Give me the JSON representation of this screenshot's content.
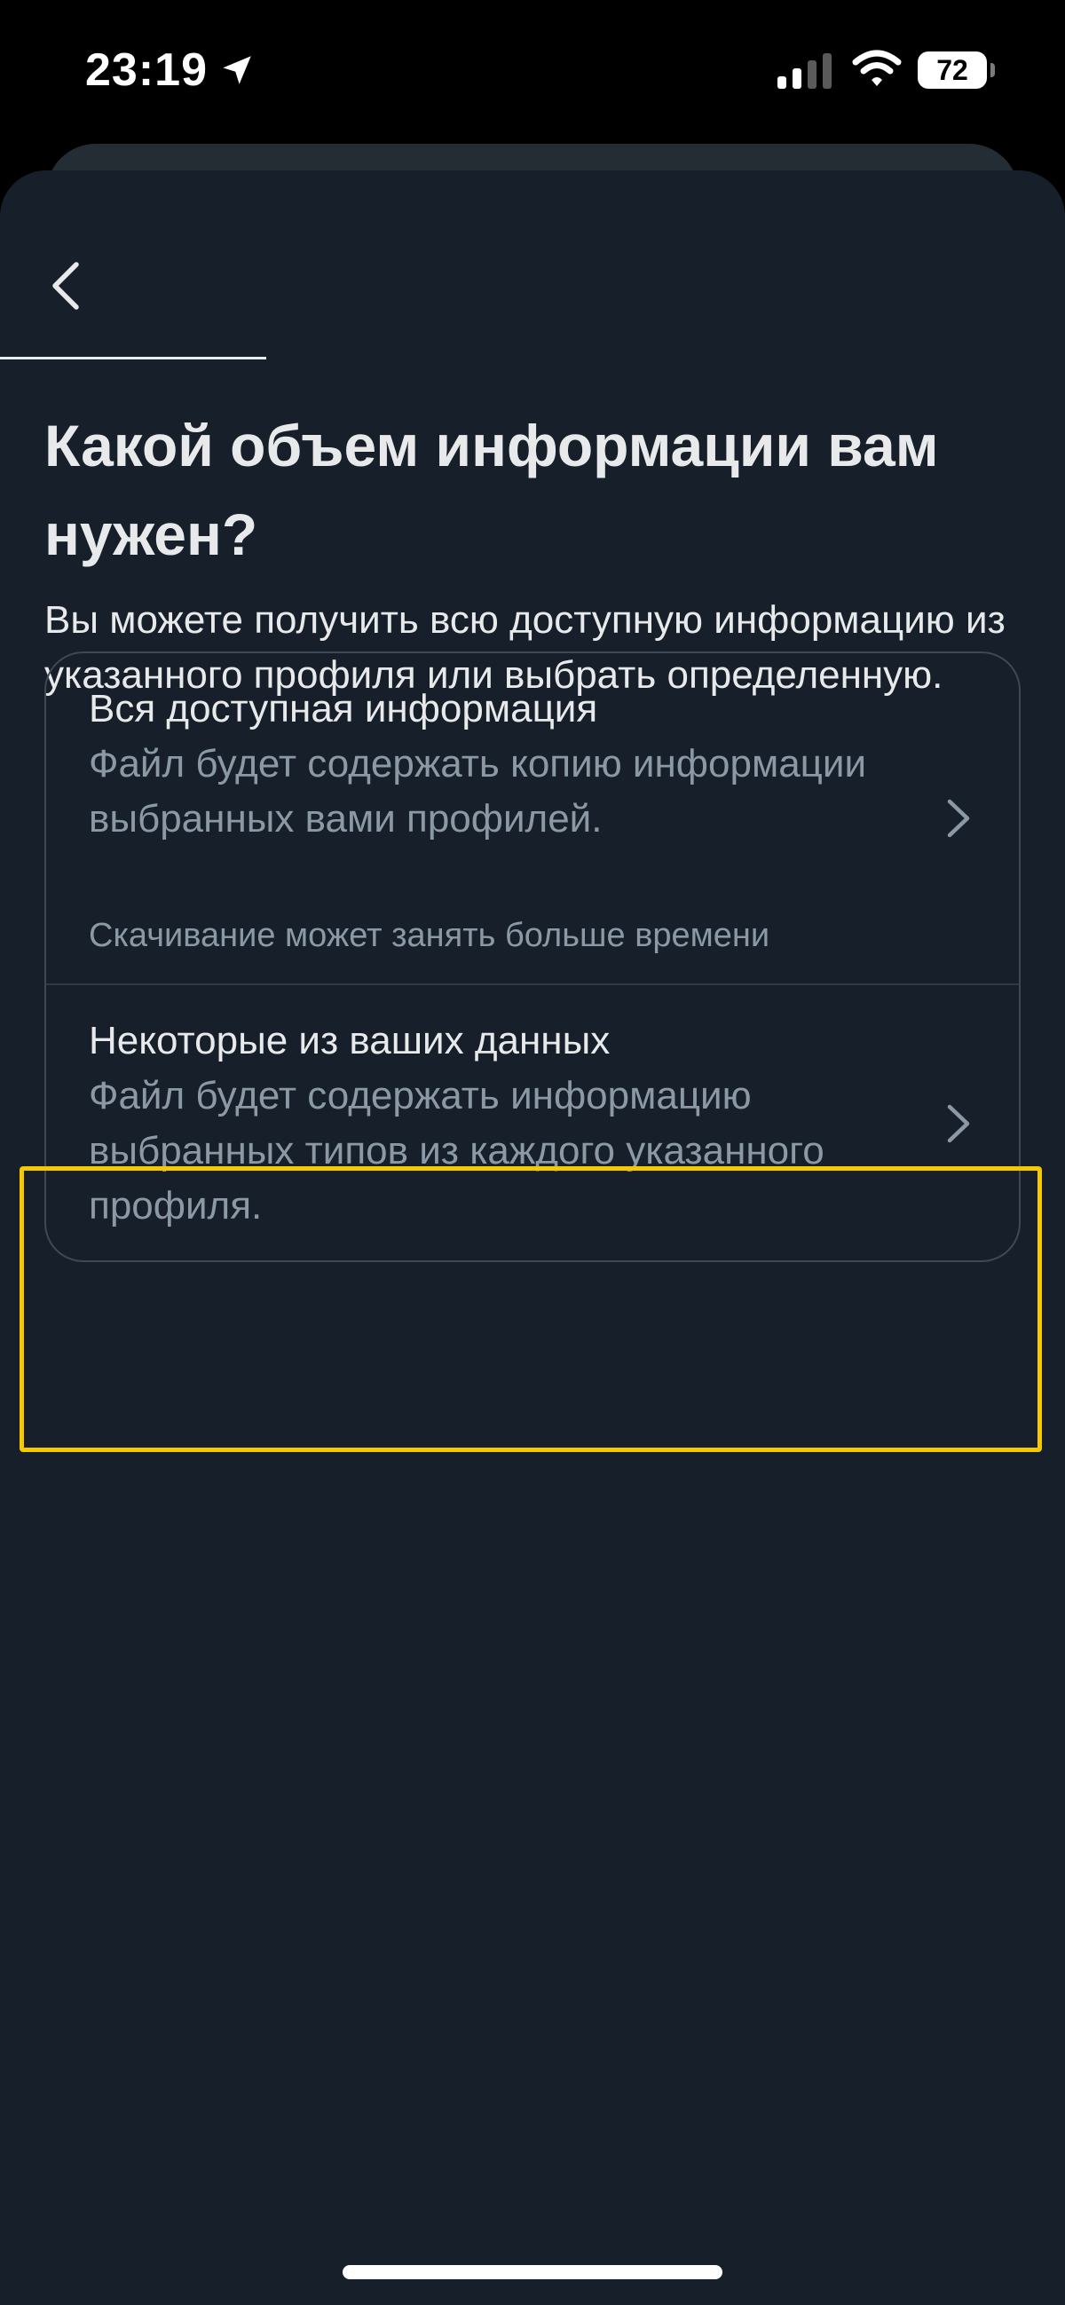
{
  "status_bar": {
    "time": "23:19",
    "battery_level": "72",
    "icons": [
      "location-arrow-icon",
      "cellular-signal-icon",
      "wifi-icon",
      "battery-icon"
    ]
  },
  "navigation": {
    "back_icon": "chevron-left-icon",
    "progress_fraction": 0.25
  },
  "header": {
    "title": "Какой объем информации вам нужен?",
    "subtitle": "Вы можете получить всю доступную информацию из указанного профиля или выбрать определенную."
  },
  "options": [
    {
      "title": "Вся доступная информация",
      "description": "Файл будет содержать копию информации выбранных вами профилей.",
      "note": "Скачивание может занять больше времени",
      "icon": "chevron-right-icon"
    },
    {
      "title": "Некоторые из ваших данных",
      "description": "Файл будет содержать информацию выбранных типов из каждого указанного профиля.",
      "icon": "chevron-right-icon",
      "highlighted": true
    }
  ],
  "colors": {
    "background": "#17202a",
    "text_primary": "#e7e9ea",
    "text_secondary": "#8b98a5",
    "card_border": "#3d4a55",
    "highlight": "#f5c800"
  }
}
